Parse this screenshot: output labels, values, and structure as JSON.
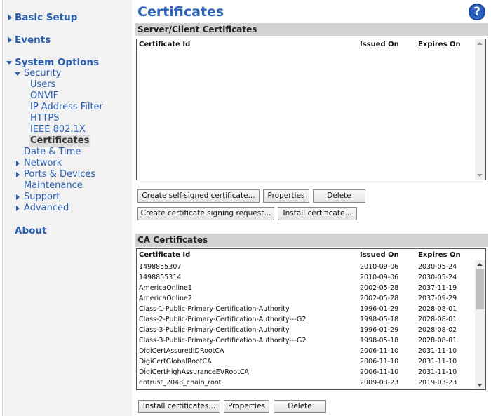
{
  "sidebar": {
    "basic_setup": "Basic Setup",
    "events": "Events",
    "system_options": "System Options",
    "security": "Security",
    "users": "Users",
    "onvif": "ONVIF",
    "ip_filter": "IP Address Filter",
    "https": "HTTPS",
    "ieee": "IEEE 802.1X",
    "certificates": "Certificates",
    "date_time": "Date & Time",
    "network": "Network",
    "ports_devices": "Ports & Devices",
    "maintenance": "Maintenance",
    "support": "Support",
    "advanced": "Advanced",
    "about": "About"
  },
  "page": {
    "title": "Certificates",
    "help": "?"
  },
  "server_client": {
    "heading": "Server/Client Certificates",
    "columns": {
      "id": "Certificate Id",
      "issued": "Issued On",
      "expires": "Expires On"
    },
    "buttons": {
      "create_self_signed": "Create self-signed certificate...",
      "properties": "Properties",
      "delete": "Delete",
      "create_csr": "Create certificate signing request...",
      "install": "Install certificate..."
    }
  },
  "ca": {
    "heading": "CA Certificates",
    "columns": {
      "id": "Certificate Id",
      "issued": "Issued On",
      "expires": "Expires On"
    },
    "rows": [
      {
        "id": "1498855307",
        "issued": "2010-09-06",
        "expires": "2030-05-24"
      },
      {
        "id": "1498855314",
        "issued": "2010-09-06",
        "expires": "2030-05-24"
      },
      {
        "id": "AmericaOnline1",
        "issued": "2002-05-28",
        "expires": "2037-11-19"
      },
      {
        "id": "AmericaOnline2",
        "issued": "2002-05-28",
        "expires": "2037-09-29"
      },
      {
        "id": "Class-1-Public-Primary-Certification-Authority",
        "issued": "1996-01-29",
        "expires": "2028-08-01"
      },
      {
        "id": "Class-2-Public-Primary-Certification-Authority---G2",
        "issued": "1998-05-18",
        "expires": "2028-08-01"
      },
      {
        "id": "Class-3-Public-Primary-Certification-Authority",
        "issued": "1996-01-29",
        "expires": "2028-08-02"
      },
      {
        "id": "Class-3-Public-Primary-Certification-Authority---G2",
        "issued": "1998-05-18",
        "expires": "2028-08-01"
      },
      {
        "id": "DigiCertAssuredIDRootCA",
        "issued": "2006-11-10",
        "expires": "2031-11-10"
      },
      {
        "id": "DigiCertGlobalRootCA",
        "issued": "2006-11-10",
        "expires": "2031-11-10"
      },
      {
        "id": "DigiCertHighAssuranceEVRootCA",
        "issued": "2006-11-10",
        "expires": "2031-11-10"
      },
      {
        "id": "entrust_2048_chain_root",
        "issued": "2009-03-23",
        "expires": "2019-03-23"
      }
    ],
    "buttons": {
      "install": "Install certificates...",
      "properties": "Properties",
      "delete": "Delete"
    }
  }
}
